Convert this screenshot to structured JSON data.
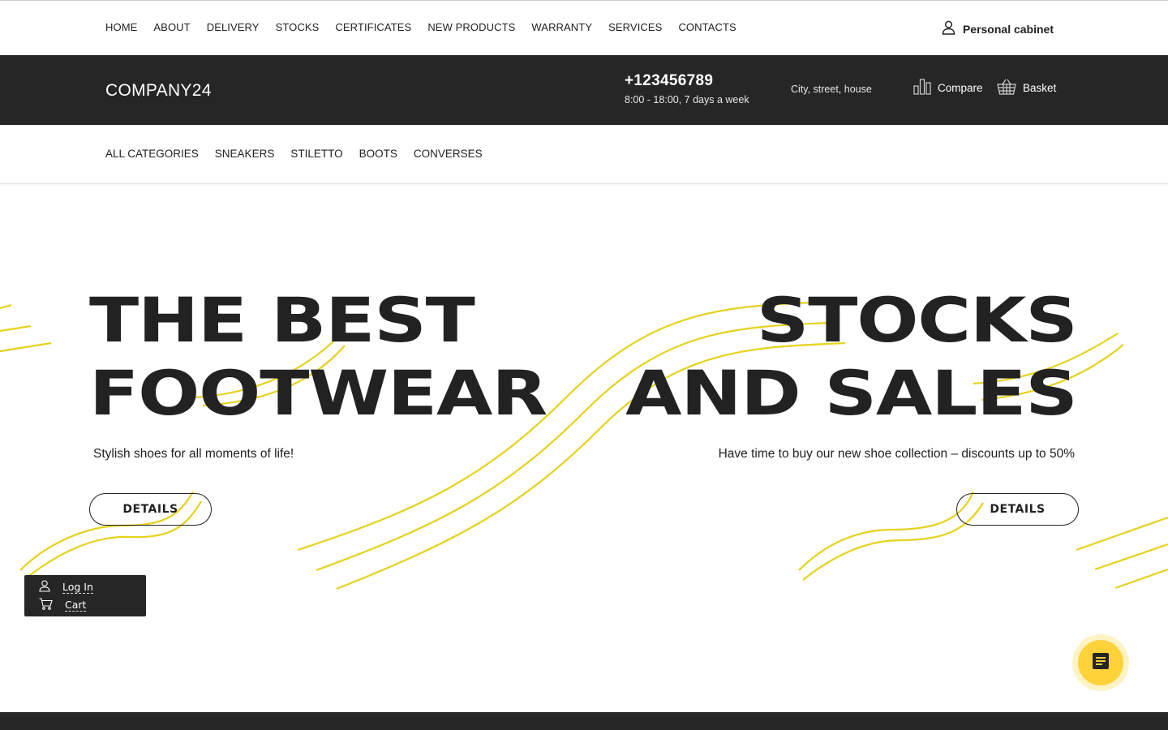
{
  "topnav": {
    "items": [
      "HOME",
      "ABOUT",
      "DELIVERY",
      "STOCKS",
      "CERTIFICATES",
      "NEW PRODUCTS",
      "WARRANTY",
      "SERVICES",
      "CONTACTS"
    ],
    "cabinet_label": "Personal cabinet"
  },
  "header": {
    "logo": "COMPANY24",
    "phone": "+123456789",
    "hours": "8:00 - 18:00, 7 days a week",
    "address": "City, street, house",
    "compare_label": "Compare",
    "basket_label": "Basket"
  },
  "categories": {
    "items": [
      "ALL CATEGORIES",
      "SNEAKERS",
      "STILETTO",
      "BOOTS",
      "CONVERSES"
    ]
  },
  "hero": {
    "left": {
      "title_line1": "THE BEST",
      "title_line2": "FOOTWEAR",
      "subtitle": "Stylish shoes for all moments of life!",
      "button": "DETAILS"
    },
    "right": {
      "title_line1": "STOCKS",
      "title_line2": "AND SALES",
      "subtitle": "Have time to buy our new shoe collection – discounts up to 50%",
      "button": "DETAILS"
    }
  },
  "float_panel": {
    "login_label": "Log In",
    "cart_label": "Cart"
  },
  "colors": {
    "dark": "#262626",
    "accent_yellow": "#ffd23a",
    "wave_yellow": "#e5d21a",
    "text": "#222222"
  },
  "icons": {
    "cabinet": "user-icon",
    "compare": "bar-chart-icon",
    "basket": "basket-icon",
    "login": "user-icon",
    "cart": "cart-icon",
    "chat": "chat-icon"
  }
}
